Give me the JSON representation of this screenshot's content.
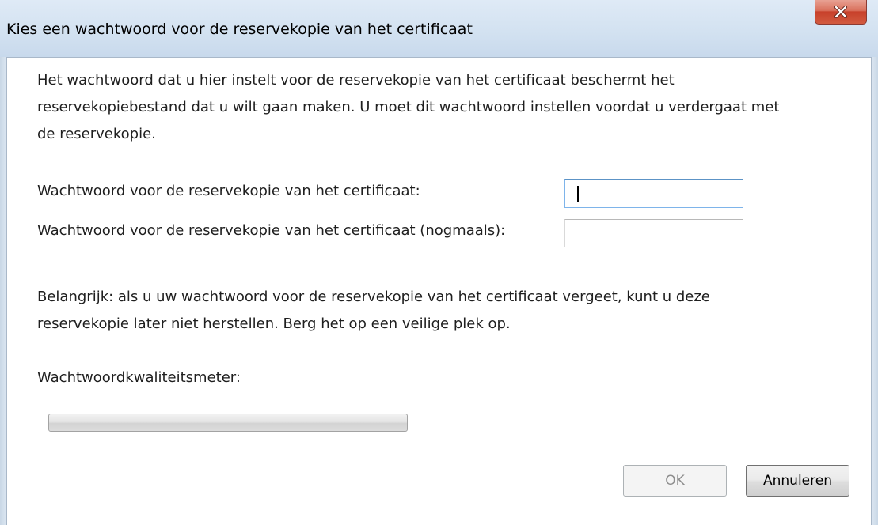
{
  "window": {
    "title": "Kies een wachtwoord voor de reservekopie van het certificaat",
    "close_icon": "close-x-icon"
  },
  "dialog": {
    "intro_lines": [
      "Het wachtwoord dat u hier instelt voor de reservekopie van het certificaat beschermt het",
      "reservekopiebestand dat u wilt gaan maken. U moet dit wachtwoord instellen voordat u verdergaat met",
      "de reservekopie."
    ],
    "password_label": "Wachtwoord voor de reservekopie van het certificaat:",
    "password_value": "",
    "confirm_label": "Wachtwoord voor de reservekopie van het certificaat (nogmaals):",
    "confirm_value": "",
    "warning_lines": [
      "Belangrijk: als u uw wachtwoord voor de reservekopie van het certificaat vergeet, kunt u deze",
      "reservekopie later niet herstellen. Berg het op een veilige plek op."
    ],
    "meter_label": "Wachtwoordkwaliteitsmeter:",
    "meter_level": 0
  },
  "buttons": {
    "ok_label": "OK",
    "ok_enabled": false,
    "cancel_label": "Annuleren"
  }
}
